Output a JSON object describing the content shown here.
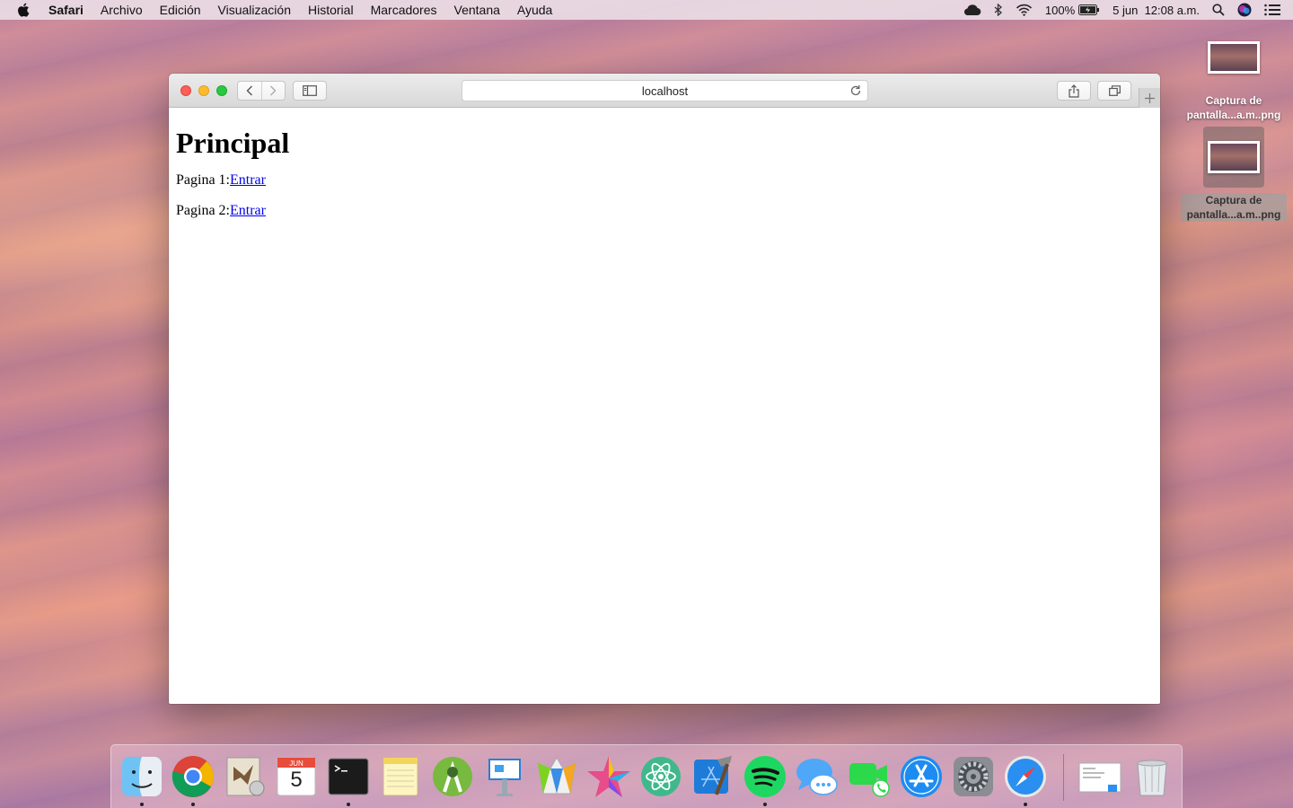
{
  "menubar": {
    "app_name": "Safari",
    "items": [
      "Archivo",
      "Edición",
      "Visualización",
      "Historial",
      "Marcadores",
      "Ventana",
      "Ayuda"
    ],
    "battery_text": "100%",
    "date_time": "5 jun  12:08 a.m."
  },
  "desktop": {
    "files": [
      {
        "name": "Captura de pantalla...a.m..png"
      },
      {
        "name": "Captura de pantalla...a.m..png"
      }
    ]
  },
  "browser": {
    "address": "localhost",
    "page": {
      "heading": "Principal",
      "rows": [
        {
          "label": "Pagina 1:",
          "link": "Entrar"
        },
        {
          "label": "Pagina 2:",
          "link": "Entrar"
        }
      ]
    }
  },
  "dock": {
    "calendar_month": "JUN",
    "calendar_day": "5",
    "apps": [
      "finder",
      "chrome",
      "mail",
      "calendar",
      "terminal",
      "notes",
      "android-studio",
      "keynote",
      "sketch-like",
      "superstar",
      "atom",
      "xcode",
      "spotify",
      "messages",
      "facetime",
      "app-store",
      "system-preferences",
      "safari",
      "preview-stack",
      "trash"
    ]
  },
  "colors": {
    "link": "#0000ee",
    "close": "#fc5f57",
    "minimize": "#fdbc2e",
    "maximize": "#28c840"
  }
}
